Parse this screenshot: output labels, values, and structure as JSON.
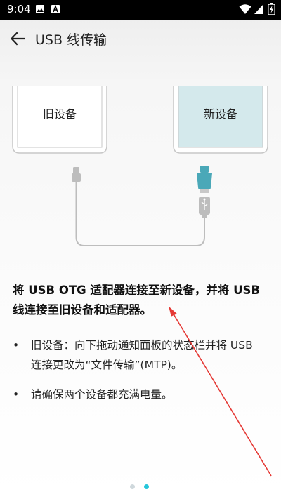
{
  "status_bar": {
    "time": "9:04",
    "icons": [
      "image-icon",
      "notification-a-icon",
      "wifi-icon",
      "signal-icon",
      "battery-charging-icon"
    ]
  },
  "app_bar": {
    "back_icon": "arrow-left-icon",
    "title": "USB 线传输"
  },
  "illustration": {
    "old_device_label": "旧设备",
    "new_device_label": "新设备",
    "colors": {
      "old_screen": "#ffffff",
      "new_screen": "#d4e9ec",
      "device_frame": "#c7c7c7",
      "cable": "#bdbdbd",
      "otg_adapter": "#4aa8b8"
    }
  },
  "instructions": {
    "headline": "将 USB OTG 适配器连接至新设备，并将 USB 线连接至旧设备和适配器。",
    "bullets": [
      "旧设备：向下拖动通知面板的状态栏并将 USB 连接更改为“文件传输”(MTP)。",
      "请确保两个设备都充满电量。"
    ]
  },
  "pager": {
    "total": 2,
    "current": 2,
    "active_color": "#26c6da",
    "inactive_color": "#cfd8dc"
  },
  "annotation": {
    "arrow_color": "#e53935"
  }
}
